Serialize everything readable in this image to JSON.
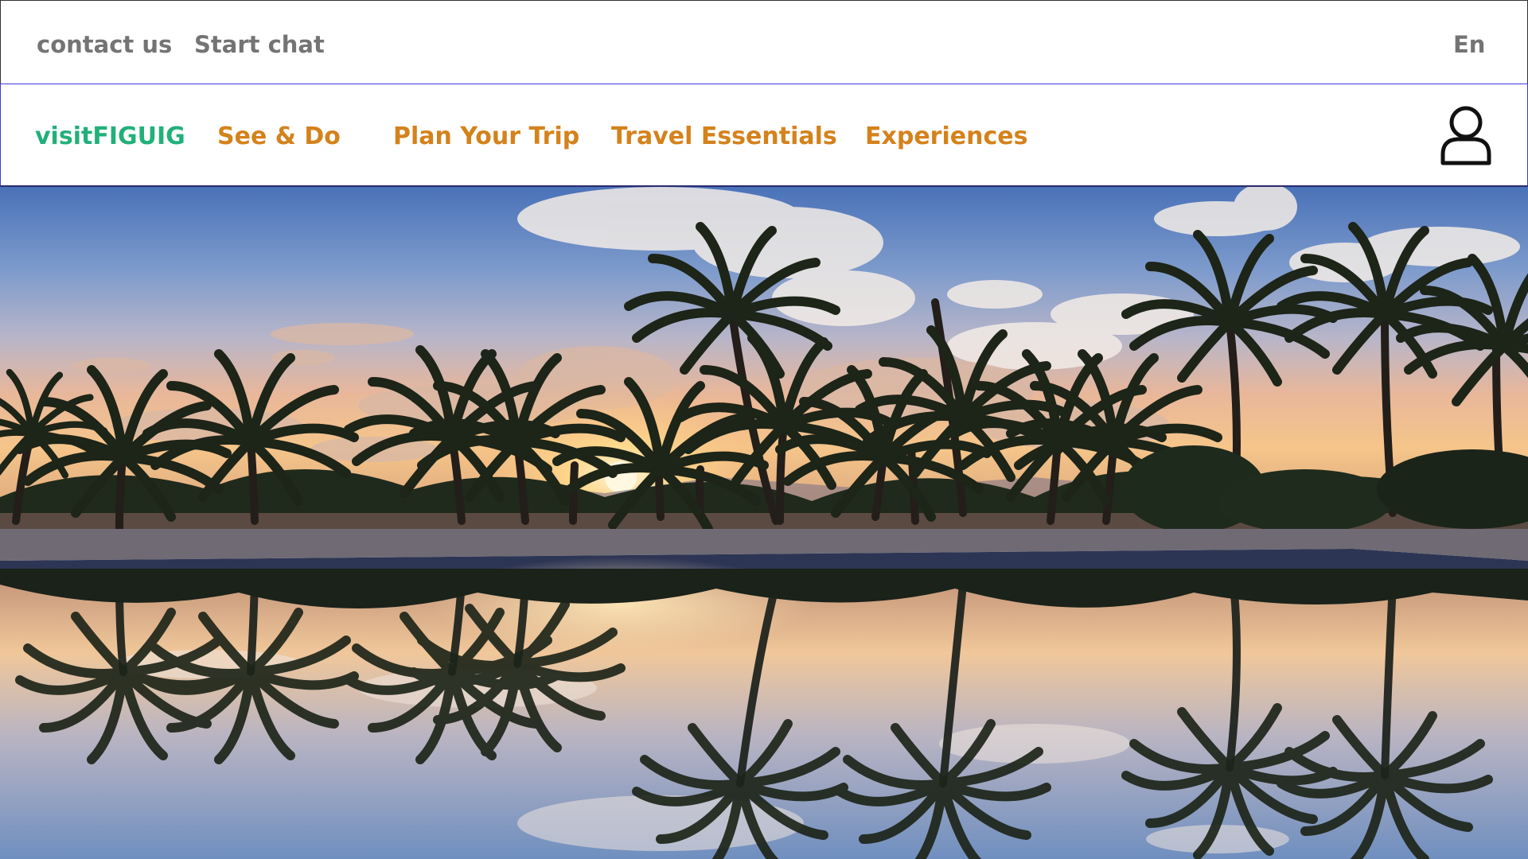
{
  "topbar": {
    "contact_label": "contact us",
    "chat_label": "Start chat",
    "language_label": "En"
  },
  "nav": {
    "brand": "visitFIGUIG",
    "items": [
      {
        "label": "See & Do"
      },
      {
        "label": "Plan Your Trip"
      },
      {
        "label": "Travel Essentials"
      },
      {
        "label": "Experiences"
      }
    ],
    "user_icon": "user-icon"
  },
  "hero": {
    "image": "sunset-palm-oasis-reflection"
  },
  "colors": {
    "brand": "#22b07a",
    "nav_text": "#d4821c",
    "top_text": "#747474"
  }
}
